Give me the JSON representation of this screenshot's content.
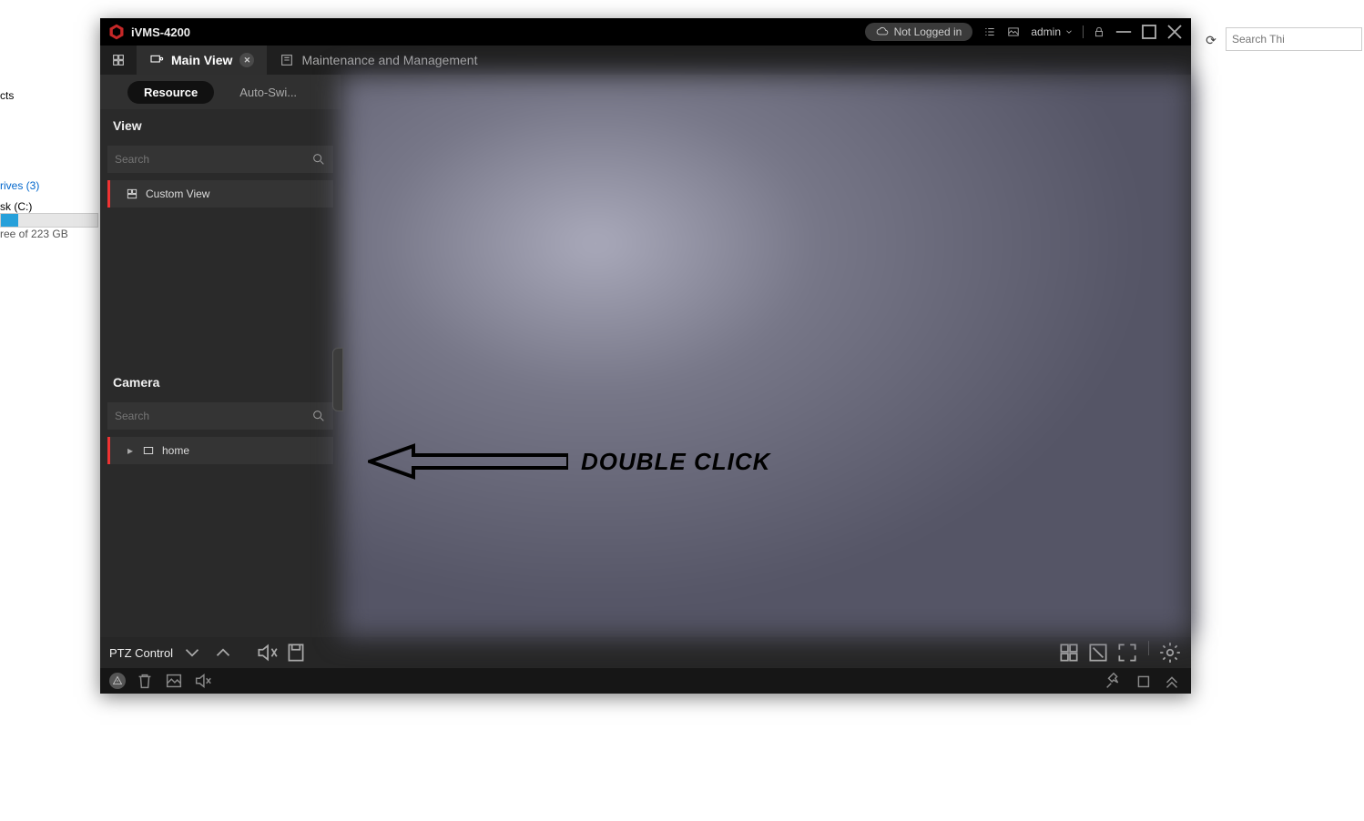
{
  "desktop": {
    "quickAccess": "cts",
    "drives": "rives (3)",
    "diskLabel": "sk (C:)",
    "diskFree": "ree of 223 GB",
    "refreshGlyph": "⟳",
    "searchPlaceholder": "Search Thi"
  },
  "app": {
    "title": "iVMS-4200",
    "loginStatus": "Not Logged in",
    "user": "admin"
  },
  "tabs": {
    "mainView": "Main View",
    "maintenance": "Maintenance and Management"
  },
  "sidebar": {
    "subtabs": {
      "resource": "Resource",
      "autoswitch": "Auto-Swi..."
    },
    "view": {
      "header": "View",
      "searchPlaceholder": "Search",
      "customView": "Custom View"
    },
    "camera": {
      "header": "Camera",
      "searchPlaceholder": "Search",
      "item": "home"
    }
  },
  "annotation": "DOUBLE CLICK",
  "ptz": {
    "label": "PTZ Control"
  }
}
